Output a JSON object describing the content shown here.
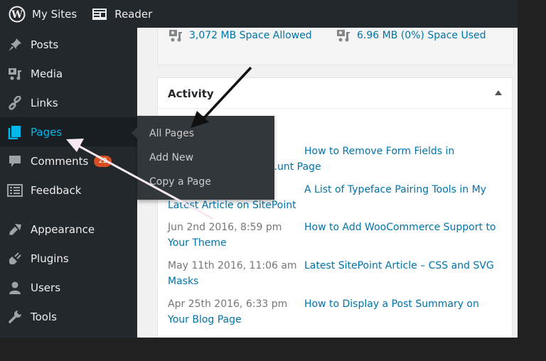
{
  "topbar": {
    "my_sites": "My Sites",
    "reader": "Reader"
  },
  "sidebar": {
    "items": [
      {
        "label": "Posts",
        "icon": "pin-icon"
      },
      {
        "label": "Media",
        "icon": "media-icon"
      },
      {
        "label": "Links",
        "icon": "link-icon"
      },
      {
        "label": "Pages",
        "icon": "pages-icon",
        "active": true
      },
      {
        "label": "Comments",
        "icon": "comment-icon",
        "badge": "22"
      },
      {
        "label": "Feedback",
        "icon": "feedback-icon"
      },
      {
        "label": "Appearance",
        "icon": "brush-icon"
      },
      {
        "label": "Plugins",
        "icon": "plugin-icon"
      },
      {
        "label": "Users",
        "icon": "user-icon"
      },
      {
        "label": "Tools",
        "icon": "wrench-icon"
      }
    ]
  },
  "flyout": {
    "items": [
      "All Pages",
      "Add New",
      "Copy a Page"
    ]
  },
  "storage": {
    "allowed": "3,072 MB Space Allowed",
    "used": "6.96 MB (0%) Space Used"
  },
  "activity": {
    "title": "Activity",
    "rows": [
      {
        "date": "",
        "title": "How to Remove Form Fields in",
        "title2": "…unt Page"
      },
      {
        "date": "",
        "title": "A List of Typeface Pairing Tools in My",
        "title2": "Latest Article on SitePoint"
      },
      {
        "date": "Jun 2nd 2016, 8:59 pm",
        "title": "How to Add WooCommerce Support to",
        "title2": "Your Theme"
      },
      {
        "date": "May 11th 2016, 11:06 am",
        "title": "Latest SitePoint Article – CSS and SVG",
        "title2": "Masks"
      },
      {
        "date": "Apr 25th 2016, 6:33 pm",
        "title": "How to Display a Post Summary on",
        "title2": "Your Blog Page"
      }
    ]
  },
  "colors": {
    "accent": "#00b9eb",
    "link": "#0073aa",
    "badge": "#d54e21",
    "sidebar_bg": "#23282d"
  }
}
